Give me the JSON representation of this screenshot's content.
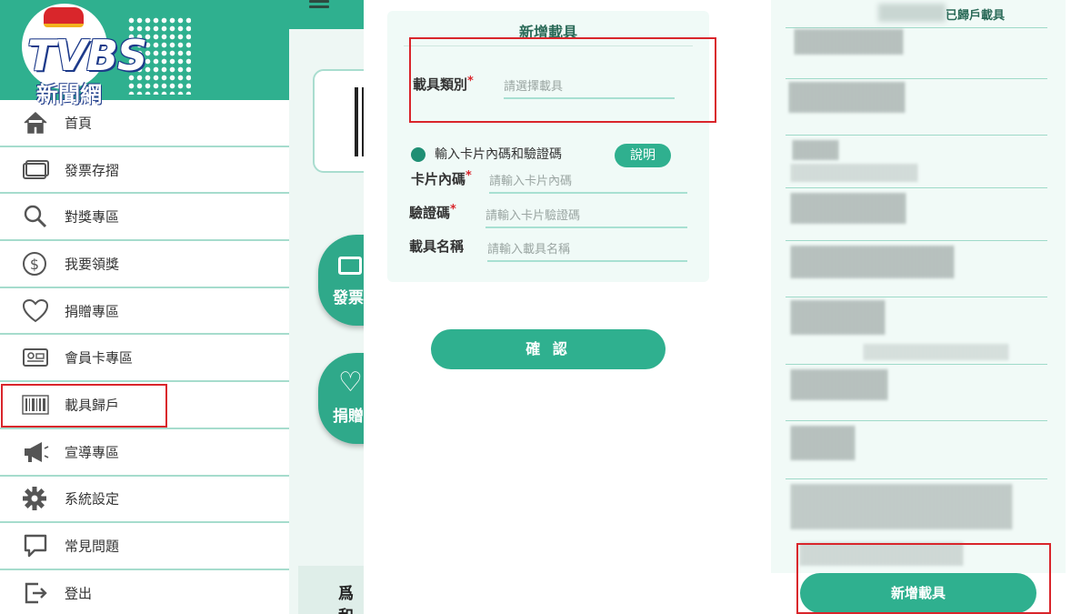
{
  "brand": {
    "logo_text": "TVBS",
    "logo_subtitle": "新聞網"
  },
  "menu": {
    "items": [
      {
        "label": "首頁",
        "icon": "home-icon"
      },
      {
        "label": "發票存摺",
        "icon": "card-icon"
      },
      {
        "label": "對獎專區",
        "icon": "search-icon"
      },
      {
        "label": "我要領獎",
        "icon": "dollar-icon"
      },
      {
        "label": "捐贈專區",
        "icon": "heart-icon"
      },
      {
        "label": "會員卡專區",
        "icon": "member-card-icon"
      },
      {
        "label": "載具歸戶",
        "icon": "barcode-icon"
      },
      {
        "label": "宣導專區",
        "icon": "megaphone-icon"
      },
      {
        "label": "系統設定",
        "icon": "gear-icon"
      },
      {
        "label": "常見問題",
        "icon": "question-icon"
      },
      {
        "label": "登出",
        "icon": "logout-icon"
      }
    ]
  },
  "background_app": {
    "button_invoice_label": "發票",
    "button_donate_label": "捐贈",
    "bottom_text": "爲和"
  },
  "form": {
    "title": "新增載具",
    "carrier_type": {
      "label": "載具類別",
      "placeholder": "請選擇載具"
    },
    "radio_option": "輸入卡片內碼和驗證碼",
    "help_button": "說明",
    "card_code": {
      "label": "卡片內碼",
      "placeholder": "請輸入卡片內碼"
    },
    "verify_code": {
      "label": "驗證碼",
      "placeholder": "請輸入卡片驗證碼"
    },
    "carrier_name": {
      "label": "載具名稱",
      "placeholder": "請輸入載具名稱"
    },
    "required_mark": "*",
    "confirm_button": "確 認"
  },
  "carrier_list": {
    "title": "已歸戶載具",
    "add_button": "新增載具"
  },
  "colors": {
    "accent": "#2fb08f",
    "highlight": "#d9252b",
    "divider": "#a6dccd"
  }
}
